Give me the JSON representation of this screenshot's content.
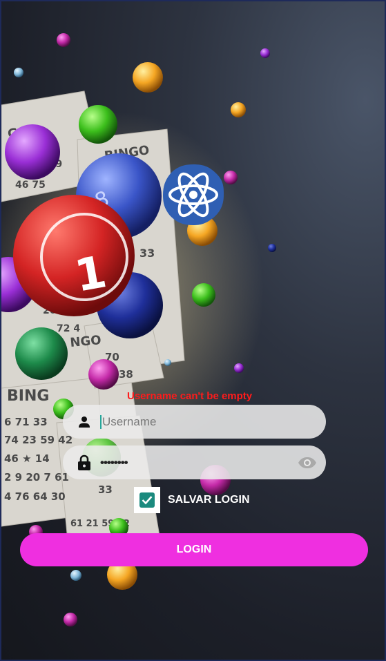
{
  "logo": {
    "icon": "atom-icon",
    "color": "#2f5fb3"
  },
  "form": {
    "error_message": "Username can't be empty",
    "username": {
      "placeholder": "Username",
      "value": "",
      "icon": "user-icon"
    },
    "password": {
      "masked_value": "••••••••",
      "icon": "lock-icon",
      "toggle_icon": "eye-icon"
    },
    "remember": {
      "label": "SALVAR LOGIN",
      "checked": true
    },
    "login_label": "LOGIN"
  },
  "colors": {
    "accent": "#ef2fe0",
    "error": "#ff1b1b",
    "checkbox": "#1b8a7e"
  }
}
